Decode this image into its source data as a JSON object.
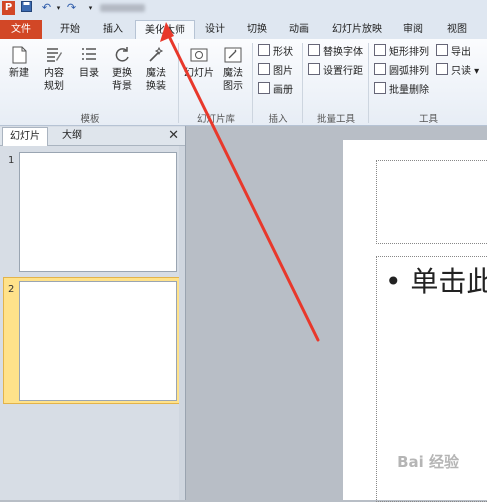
{
  "qat": {
    "app_icon": "P",
    "save_icon": "save-icon",
    "undo_icon": "undo-icon",
    "redo_icon": "redo-icon"
  },
  "tabs": [
    {
      "label": "文件"
    },
    {
      "label": "开始"
    },
    {
      "label": "插入"
    },
    {
      "label": "美化大师"
    },
    {
      "label": "设计"
    },
    {
      "label": "切换"
    },
    {
      "label": "动画"
    },
    {
      "label": "幻灯片放映"
    },
    {
      "label": "审阅"
    },
    {
      "label": "视图"
    }
  ],
  "ribbon": {
    "large_buttons": [
      {
        "label_1": "新建",
        "label_2": ""
      },
      {
        "label_1": "内容",
        "label_2": "规划"
      },
      {
        "label_1": "目录",
        "label_2": ""
      },
      {
        "label_1": "更换",
        "label_2": "背景"
      },
      {
        "label_1": "魔法",
        "label_2": "换装"
      },
      {
        "label_1": "幻灯片",
        "label_2": ""
      },
      {
        "label_1": "魔法",
        "label_2": "图示"
      }
    ],
    "insert_items": [
      "形状",
      "图片",
      "画册"
    ],
    "batch_items": [
      "替换字体",
      "设置行距"
    ],
    "tool_items": [
      "矩形排列",
      "圆弧排列",
      "批量删除",
      "导出",
      "只读"
    ],
    "groups": [
      "模板",
      "幻灯片库",
      "插入",
      "批量工具",
      "工具"
    ]
  },
  "pane": {
    "tabs": [
      "幻灯片",
      "大纲"
    ],
    "close": "✕",
    "slides": [
      {
        "number": "1"
      },
      {
        "number": "2"
      }
    ]
  },
  "slide": {
    "bullet_text": "单击此"
  },
  "watermark": "Bai 经验"
}
